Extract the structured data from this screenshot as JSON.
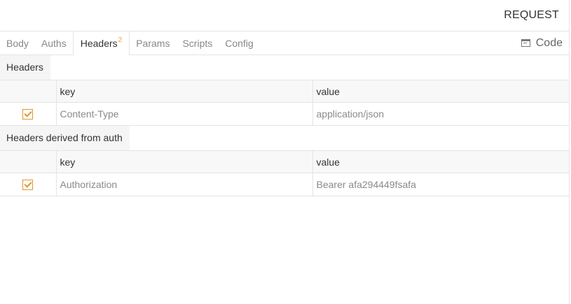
{
  "header": {
    "title": "REQUEST"
  },
  "tabs": [
    {
      "label": "Body"
    },
    {
      "label": "Auths"
    },
    {
      "label": "Headers",
      "badge": "2"
    },
    {
      "label": "Params"
    },
    {
      "label": "Scripts"
    },
    {
      "label": "Config"
    }
  ],
  "active_tab": "Headers",
  "code_button": {
    "label": "Code",
    "icon": "code-window-icon"
  },
  "headers_section": {
    "title": "Headers",
    "columns": [
      "key",
      "value"
    ],
    "rows": [
      {
        "checked": true,
        "key": "Content-Type",
        "value": "application/json"
      }
    ]
  },
  "derived_section": {
    "title": "Headers derived from auth",
    "columns": [
      "key",
      "value"
    ],
    "rows": [
      {
        "checked": true,
        "key": "Authorization",
        "value": "Bearer afa294449fsafa"
      }
    ]
  },
  "colors": {
    "accent": "#e0962f",
    "border": "#e4e4e4",
    "muted_text": "#8a8a8a"
  }
}
